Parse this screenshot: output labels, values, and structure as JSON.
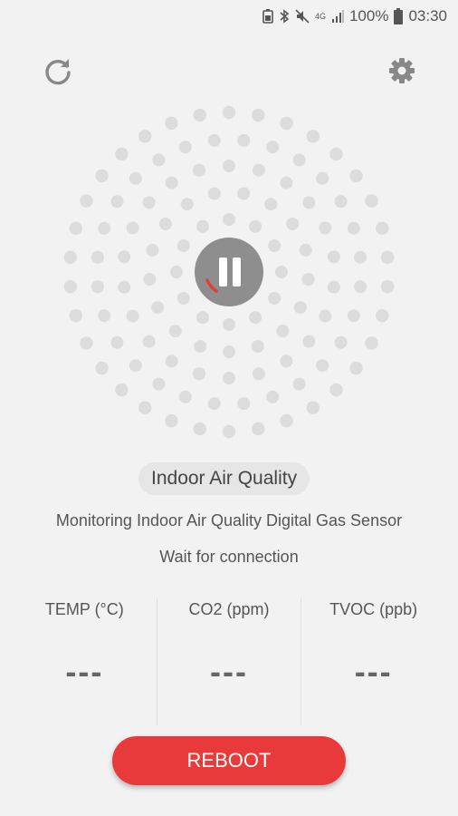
{
  "status_bar": {
    "battery": "100%",
    "time": "03:30",
    "network": "4G"
  },
  "toolbar": {
    "refresh_icon": "refresh-icon",
    "settings_icon": "gear-icon"
  },
  "title": "Indoor Air Quality",
  "subtitle": "Monitoring Indoor Air Quality Digital Gas Sensor",
  "status": "Wait for connection",
  "metrics": [
    {
      "label": "TEMP (°C)",
      "value": "---"
    },
    {
      "label": "CO2 (ppm)",
      "value": "---"
    },
    {
      "label": "TVOC (ppb)",
      "value": "---"
    }
  ],
  "reboot_label": "REBOOT",
  "colors": {
    "accent": "#e83a3a",
    "dot": "#dcdcdc",
    "pause_bg": "#8e8e8e",
    "background": "#f2f2f2"
  }
}
